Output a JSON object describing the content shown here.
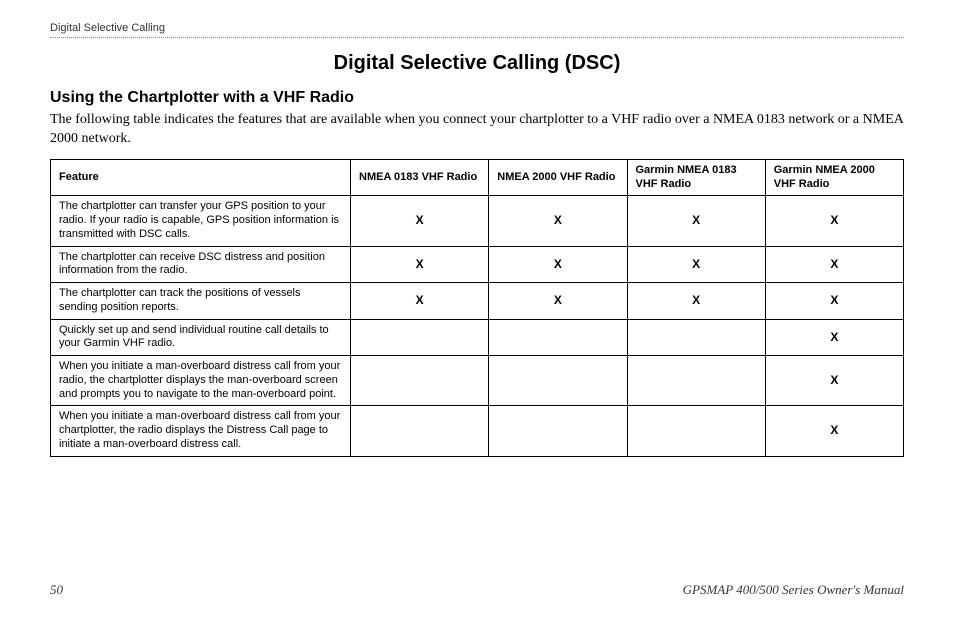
{
  "running_head": "Digital Selective Calling",
  "title": "Digital Selective Calling (DSC)",
  "subtitle": "Using the Chartplotter with a VHF Radio",
  "intro": "The following table indicates the features that are available when you connect your chartplotter to a VHF radio over a NMEA 0183 network or a NMEA 2000 network.",
  "table": {
    "headers": {
      "feature": "Feature",
      "c1": "NMEA 0183 VHF Radio",
      "c2": "NMEA 2000 VHF Radio",
      "c3": "Garmin NMEA 0183 VHF Radio",
      "c4": "Garmin NMEA 2000 VHF Radio"
    },
    "rows": [
      {
        "feature": "The chartplotter can transfer your GPS position to your radio. If your radio is capable, GPS position information is transmitted with DSC calls.",
        "c1": "X",
        "c2": "X",
        "c3": "X",
        "c4": "X"
      },
      {
        "feature": "The chartplotter can receive DSC distress and position information from the radio.",
        "c1": "X",
        "c2": "X",
        "c3": "X",
        "c4": "X"
      },
      {
        "feature": "The chartplotter can track the positions of vessels sending position reports.",
        "c1": "X",
        "c2": "X",
        "c3": "X",
        "c4": "X"
      },
      {
        "feature": "Quickly set up and send individual routine call details to your Garmin VHF radio.",
        "c1": "",
        "c2": "",
        "c3": "",
        "c4": "X"
      },
      {
        "feature": "When you initiate a man-overboard distress call from your radio, the chartplotter displays the man-overboard screen and prompts you to navigate to the man-overboard point.",
        "c1": "",
        "c2": "",
        "c3": "",
        "c4": "X"
      },
      {
        "feature": "When you initiate a man-overboard distress call from your chartplotter, the radio displays the Distress Call page to initiate a man-overboard distress call.",
        "c1": "",
        "c2": "",
        "c3": "",
        "c4": "X"
      }
    ]
  },
  "footer": {
    "page_number": "50",
    "manual_title": "GPSMAP 400/500 Series Owner's Manual"
  }
}
